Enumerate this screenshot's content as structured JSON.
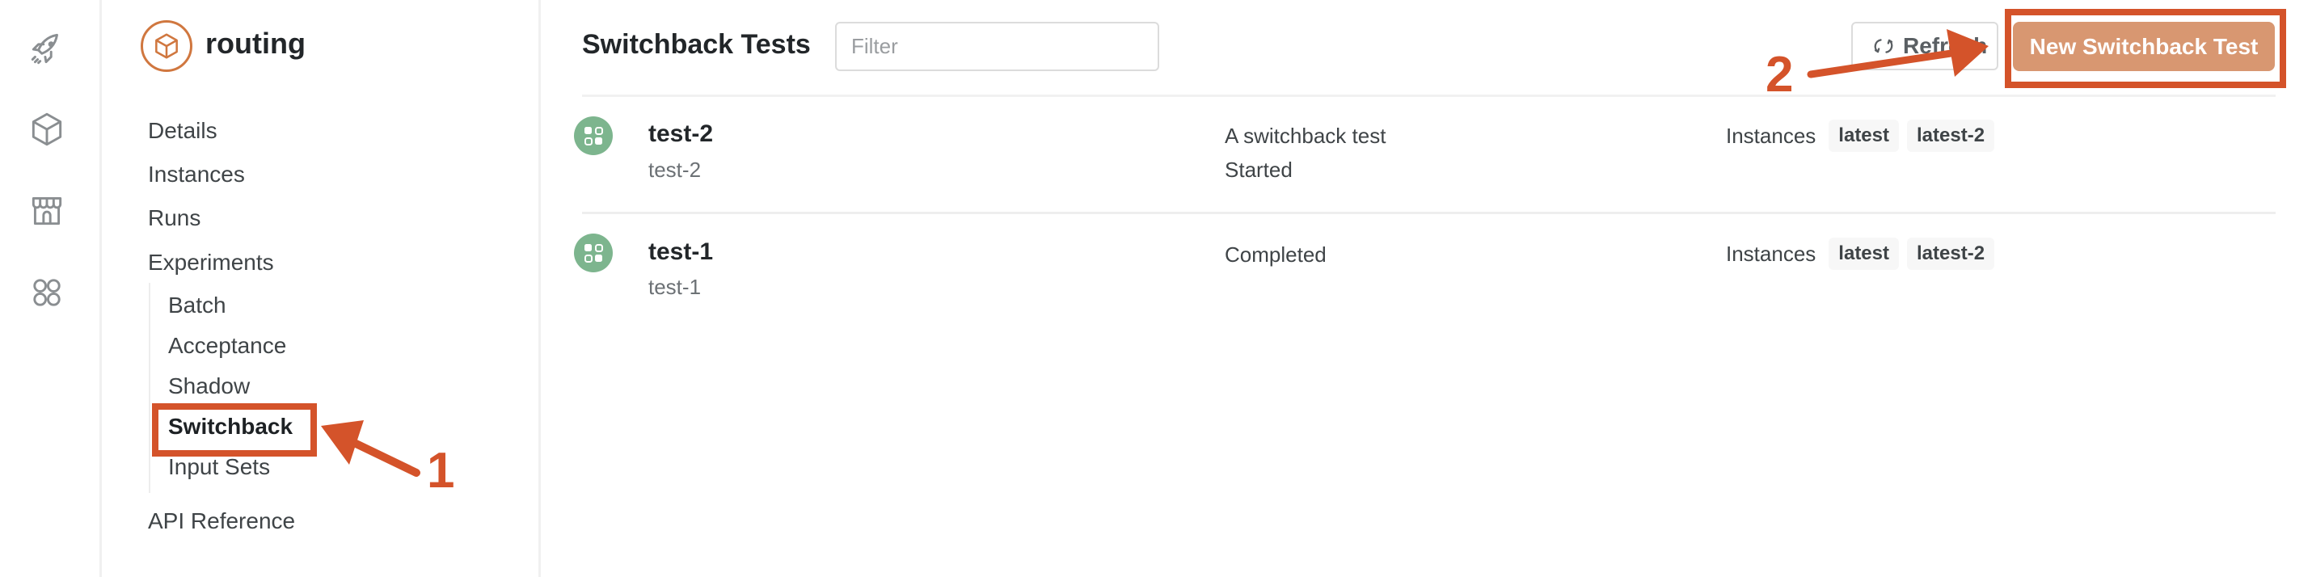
{
  "rail": {
    "items": [
      {
        "icon": "rocket-icon",
        "label": "Launch"
      },
      {
        "icon": "cube-icon",
        "label": "Apps"
      },
      {
        "icon": "storefront-icon",
        "label": "Marketplace"
      },
      {
        "icon": "grid-circles-icon",
        "label": "More"
      }
    ]
  },
  "sidebar": {
    "project_name": "routing",
    "project_icon": "cube-icon",
    "items": [
      {
        "label": "Details"
      },
      {
        "label": "Instances"
      },
      {
        "label": "Runs"
      },
      {
        "label": "Experiments"
      }
    ],
    "experiments_sub": [
      {
        "label": "Batch"
      },
      {
        "label": "Acceptance"
      },
      {
        "label": "Shadow"
      },
      {
        "label": "Switchback",
        "active": true
      },
      {
        "label": "Input Sets"
      }
    ],
    "api_reference": "API Reference"
  },
  "header": {
    "title": "Switchback Tests",
    "filter_placeholder": "Filter",
    "filter_value": "",
    "refresh_label": "Refresh",
    "new_button_label": "New Switchback Test"
  },
  "tests": [
    {
      "name": "test-2",
      "id": "test-2",
      "description": "A switchback test",
      "status": "Started",
      "instances_label": "Instances",
      "instances": [
        "latest",
        "latest-2"
      ]
    },
    {
      "name": "test-1",
      "id": "test-1",
      "description": "",
      "status": "Completed",
      "instances_label": "Instances",
      "instances": [
        "latest",
        "latest-2"
      ]
    }
  ],
  "annotations": [
    {
      "number": "1",
      "target": "Switchback"
    },
    {
      "number": "2",
      "target": "New Switchback Test"
    }
  ],
  "colors": {
    "accent": "#d0773f",
    "primary_button": "#d89771",
    "test_icon": "#7db58e",
    "annotation": "#d4532a"
  }
}
